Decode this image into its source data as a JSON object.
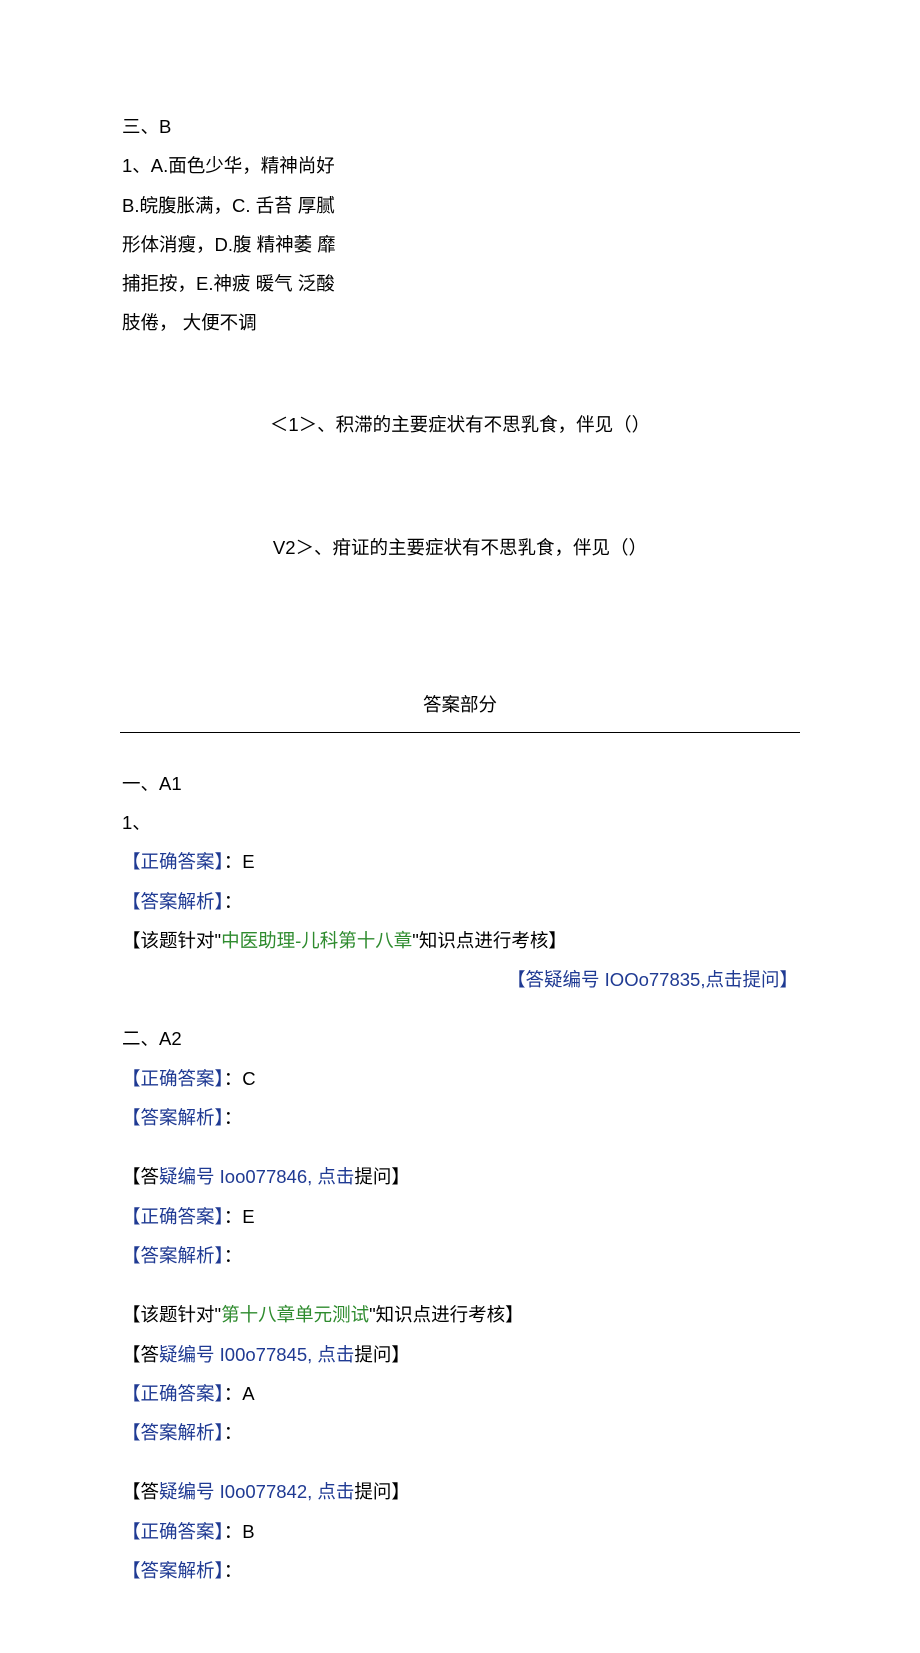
{
  "sectionB": {
    "header": "三、B",
    "q1": {
      "stem": "1、A.面色少华，精神尚好",
      "lineB": "B.皖腹胀满，C. 舌苔 厚腻",
      "lineC": "形体消瘦，D.腹 精神萎 靡",
      "lineD": "捕拒按，E.神疲 暖气 泛酸",
      "lineE": "肢倦，           大便不调"
    },
    "sub1": "＜1＞、积滞的主要症状有不思乳食，伴见（）",
    "sub2": "V2＞、疳证的主要症状有不思乳食，伴见（）"
  },
  "answerHeader": "答案部分",
  "a1": {
    "header": "一、A1",
    "q1num": "1、",
    "correctLabel": "【正确答案】",
    "correctVal": "：E",
    "analysisLabel": "【答案解析】",
    "analysisColon": "：",
    "topic": {
      "open": "【该",
      "mid": "题针对",
      "quote1": "\"",
      "green": "中医助理-儿科第十八章",
      "quote2": "\"",
      "tail": "知识点进行考核】"
    },
    "askLine": {
      "open": "【答疑编号 IOOo77835,",
      "link": "点击提问",
      "close": "】"
    }
  },
  "a2": {
    "header": "二、A2",
    "items": [
      {
        "correctVal": "：C",
        "askLine": {
          "pre": "【答",
          "mid": "疑编号 Ioo077846, ",
          "link": "点击",
          "post": "提问】"
        }
      },
      {
        "correctVal": "：E",
        "topic": {
          "pre": "【该题针对\"",
          "green": "第十八章单元测试",
          "post": "\"知识点进行考核】"
        },
        "askLine": {
          "pre": "【答",
          "mid": "疑编号 I00o77845, ",
          "link": "点击",
          "post": "提问】"
        }
      },
      {
        "correctVal": "：A",
        "askLine": {
          "pre": "【答",
          "mid": "疑编号 I0o077842, ",
          "link": "点击",
          "post": "提问】"
        }
      },
      {
        "correctVal": "：B"
      }
    ],
    "labels": {
      "correct": "【正确答案】",
      "analysis": "【答案解析】",
      "colon": "："
    }
  }
}
